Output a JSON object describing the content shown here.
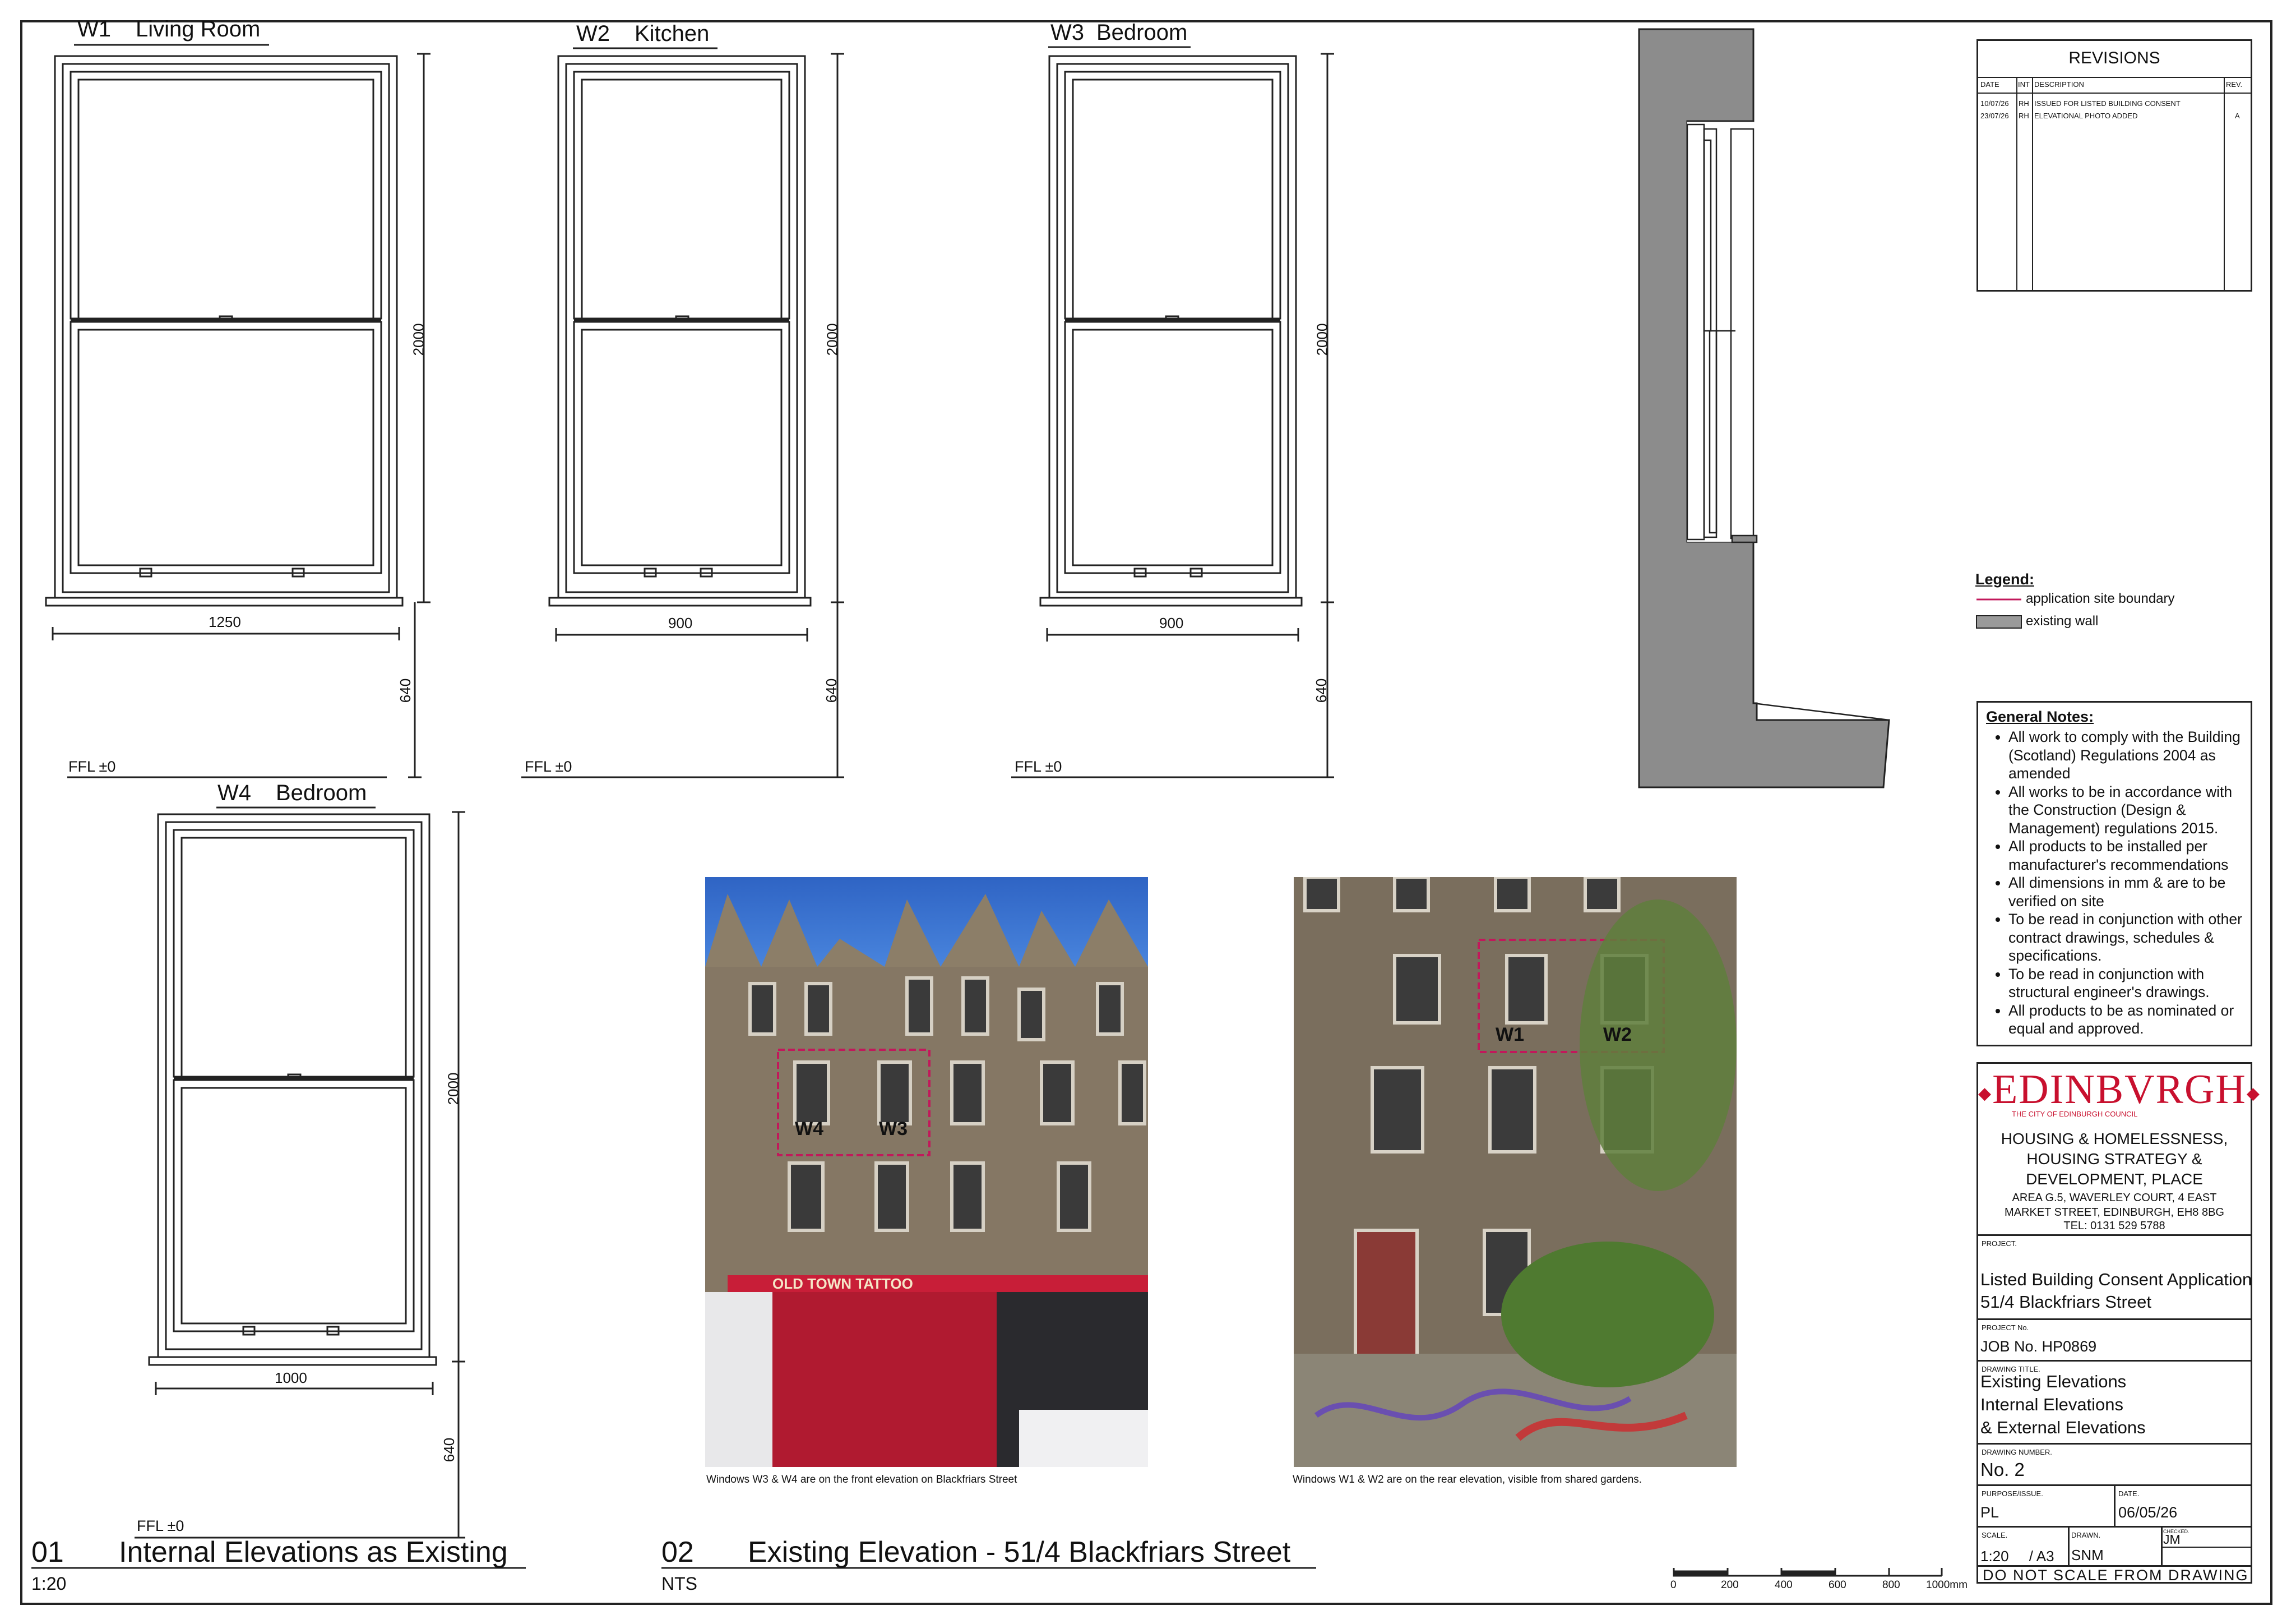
{
  "windows": {
    "w1": {
      "id": "W1",
      "name": "Living Room",
      "width": "1250",
      "height": "2000",
      "sill_height": "640",
      "ffl": "FFL ±0"
    },
    "w2": {
      "id": "W2",
      "name": "Kitchen",
      "width": "900",
      "height": "2000",
      "sill_height": "640",
      "ffl": "FFL ±0"
    },
    "w3": {
      "id": "W3",
      "name": "Bedroom",
      "width": "900",
      "height": "2000",
      "sill_height": "640",
      "ffl": "FFL ±0"
    },
    "w4": {
      "id": "W4",
      "name": "Bedroom",
      "width": "1000",
      "height": "2000",
      "sill_height": "640",
      "ffl": "FFL ±0"
    }
  },
  "revisions": {
    "title": "REVISIONS",
    "headers": {
      "date": "DATE",
      "init": "INT",
      "desc": "DESCRIPTION",
      "rev": "REV."
    },
    "rows": [
      {
        "date": "10/07/26",
        "init": "RH",
        "desc": "ISSUED FOR LISTED BUILDING CONSENT",
        "rev": ""
      },
      {
        "date": "23/07/26",
        "init": "RH",
        "desc": "ELEVATIONAL PHOTO ADDED",
        "rev": "A"
      }
    ]
  },
  "legend": {
    "title": "Legend:",
    "items": [
      {
        "label": "application site boundary",
        "color": "#c2185b"
      },
      {
        "label": "existing wall",
        "color": "#9a9a9a"
      }
    ]
  },
  "notes": {
    "title": "General Notes:",
    "items": [
      "All work to comply with the Building (Scotland) Regulations 2004 as amended",
      "All works to be in accordance with the Construction (Design & Management) regulations 2015.",
      "All products to be installed per manufacturer's recommendations",
      "All dimensions in mm & are to be verified on site",
      "To be read in conjunction with other contract drawings, schedules & specifications.",
      "To be read in conjunction with structural engineer's drawings.",
      "All products to be as nominated or equal and approved."
    ]
  },
  "council": {
    "logo": "EDINBVRGH",
    "tagline": "THE CITY OF EDINBURGH COUNCIL",
    "dept1": "HOUSING & HOMELESSNESS,",
    "dept2": "HOUSING STRATEGY &",
    "dept3": "DEVELOPMENT, PLACE",
    "addr1": "AREA G.5, WAVERLEY COURT, 4 EAST",
    "addr2": "MARKET STREET, EDINBURGH, EH8 8BG",
    "tel": "TEL: 0131 529 5788",
    "brand_color": "#c8102e"
  },
  "titleblock": {
    "project_label": "PROJECT.",
    "project1": "Listed Building Consent Application",
    "project2": "51/4 Blackfriars Street",
    "projno_label": "PROJECT No.",
    "projno": "JOB No. HP0869",
    "drawing_title_label": "DRAWING TITLE.",
    "title1": "Existing Elevations",
    "title2": "Internal Elevations",
    "title3": "& External Elevations",
    "drawing_no_label": "DRAWING NUMBER.",
    "drawing_no": "No. 2",
    "purpose_label": "PURPOSE/ISSUE.",
    "purpose": "PL",
    "date_label": "DATE.",
    "date": "06/05/26",
    "scale_label": "SCALE.",
    "scale": "1:20     / A3",
    "drawn_label": "DRAWN.",
    "drawn": "SNM",
    "checked_label": "CHECKED.",
    "checked": "JM",
    "warning": "DO NOT SCALE FROM DRAWING"
  },
  "photos": {
    "front_caption": "Windows W3 & W4 are on the front elevation on Blackfriars Street",
    "rear_caption": "Windows W1 & W2 are on the rear elevation, visible from shared gardens.",
    "front_tags": [
      "W4",
      "W3"
    ],
    "rear_tags": [
      "W1",
      "W2"
    ],
    "shop_sign": "OLD TOWN TATTOO"
  },
  "drawings": {
    "d1_num": "01",
    "d1_title": "Internal Elevations as Existing",
    "d1_scale": "1:20",
    "d2_num": "02",
    "d2_title": "Existing Elevation - 51/4 Blackfriars Street",
    "d2_scale": "NTS"
  },
  "scalebar": {
    "ticks": [
      "0",
      "200",
      "400",
      "600",
      "800",
      "1000mm"
    ]
  }
}
